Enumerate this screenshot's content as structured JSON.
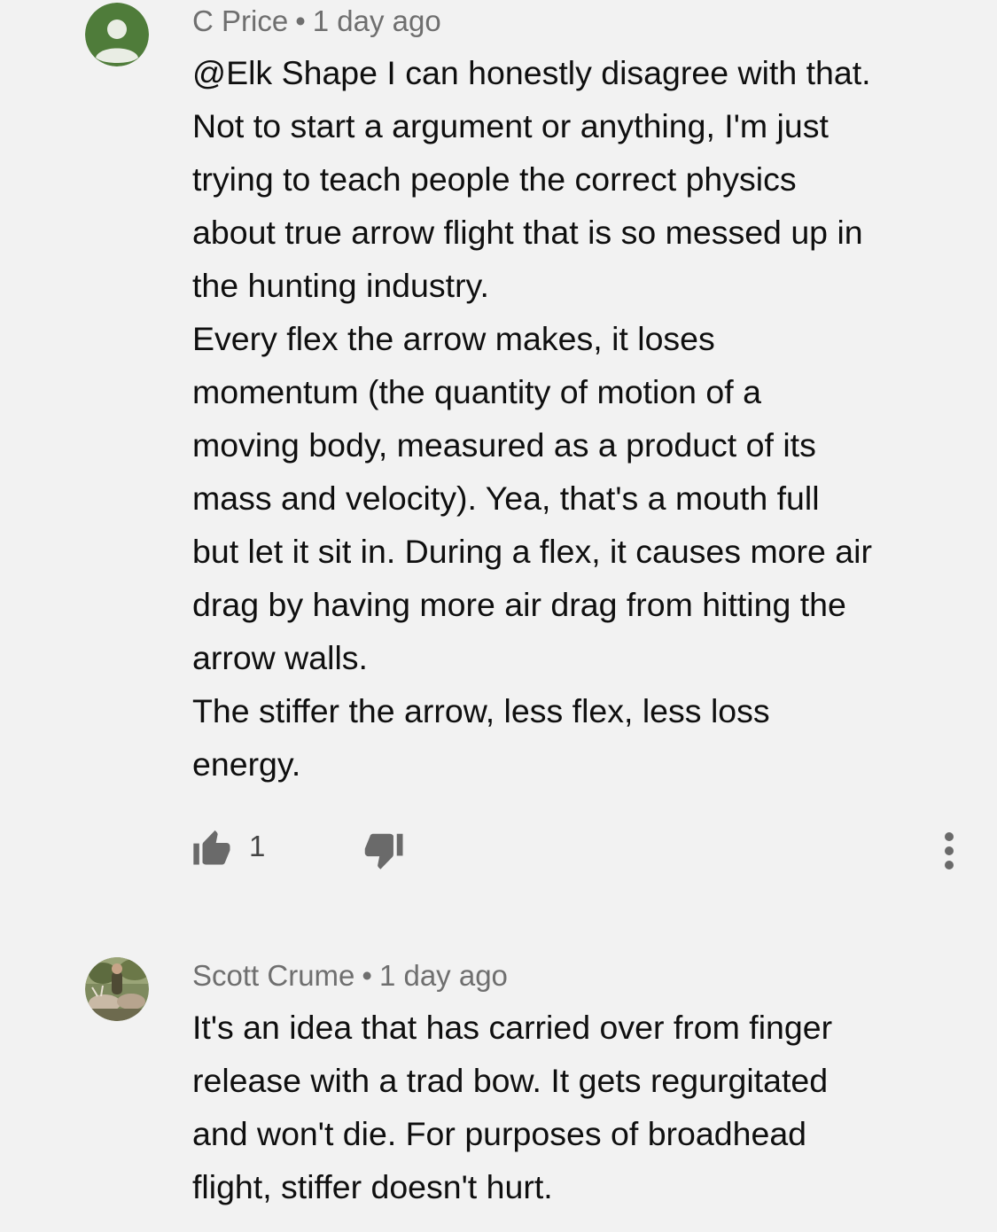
{
  "comments": [
    {
      "author": "C Price",
      "time": "1 day ago",
      "separator": "•",
      "avatar_color": "#4f7c3a",
      "lines": [
        "@Elk Shape I can honestly disagree with that.",
        "Not to start a argument or anything, I'm just",
        "trying to teach people the correct physics",
        "about true arrow flight that is so messed up in",
        "the hunting industry.",
        "Every flex the arrow makes, it loses",
        "momentum (the quantity of motion of a",
        "moving body, measured as a product of its",
        "mass and velocity). Yea, that's a mouth full",
        "but let it sit in. During a flex, it causes more air",
        "drag by having more air drag from hitting the",
        "arrow walls.",
        "The stiffer the arrow, less flex, less loss",
        "energy."
      ],
      "likes": "1"
    },
    {
      "author": "Scott Crume",
      "time": "1 day ago",
      "separator": "•",
      "lines": [
        "It's an idea that has carried over from finger",
        "release with a trad bow.  It gets regurgitated",
        "and won't die.  For purposes of broadhead",
        "flight,  stiffer doesn't hurt."
      ]
    }
  ],
  "icons": {
    "like": "thumbs-up-icon",
    "dislike": "thumbs-down-icon",
    "more": "more-vert-icon"
  }
}
